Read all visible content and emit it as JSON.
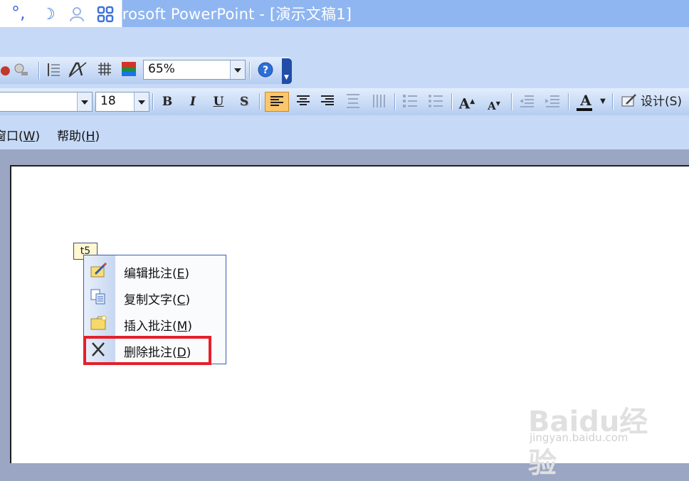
{
  "window": {
    "title": "crosoft PowerPoint - [演示文稿1]"
  },
  "ime_bar": {
    "icons": [
      "punctuation-icon",
      "moon-icon",
      "user-icon",
      "grid-icon"
    ],
    "accent": "#3d72d8"
  },
  "toolbar_standard": {
    "zoom_value": "65%",
    "icons": [
      "research-icon",
      "sort-icon",
      "format-icon",
      "grid-icon",
      "color-icon",
      "help-icon"
    ]
  },
  "toolbar_formatting": {
    "font_size": "18",
    "bold": "B",
    "italic": "I",
    "underline": "U",
    "shadow": "S",
    "design_label": "设计(S)"
  },
  "menu": {
    "items": [
      {
        "label": "窗口",
        "accel": "W"
      },
      {
        "label": "帮助",
        "accel": "H"
      }
    ]
  },
  "comment_marker": {
    "text": "t5"
  },
  "context_menu": {
    "items": [
      {
        "label": "编辑批注",
        "accel": "E",
        "icon": "edit-comment-icon"
      },
      {
        "label": "复制文字",
        "accel": "C",
        "icon": "copy-text-icon"
      },
      {
        "label": "插入批注",
        "accel": "M",
        "icon": "insert-comment-icon"
      },
      {
        "label": "删除批注",
        "accel": "D",
        "icon": "delete-icon"
      }
    ],
    "highlighted_index": 3,
    "highlight_color": "#e4202b"
  },
  "watermark": {
    "logo": "Baidu经验",
    "url": "jingyan.baidu.com"
  }
}
